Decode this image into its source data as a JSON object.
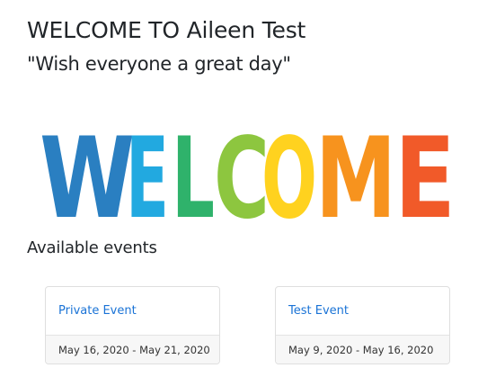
{
  "header": {
    "title": "WELCOME TO Aileen Test",
    "subtitle": "\"Wish everyone a great day\""
  },
  "banner": {
    "letters": [
      "W",
      "E",
      "L",
      "C",
      "O",
      "M",
      "E"
    ],
    "colors": [
      "#2a7fc1",
      "#22a9e0",
      "#2fb26b",
      "#8dc63f",
      "#ffd21f",
      "#f7931e",
      "#f15a29"
    ]
  },
  "events": {
    "heading": "Available events",
    "items": [
      {
        "name": "Private Event",
        "dates": "May 16, 2020 - May 21, 2020"
      },
      {
        "name": "Test Event",
        "dates": "May 9, 2020 - May 16, 2020"
      }
    ]
  }
}
